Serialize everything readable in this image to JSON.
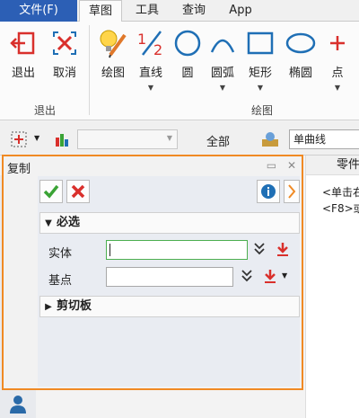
{
  "tabs": [
    {
      "label": "文件(F)"
    },
    {
      "label": "草图"
    },
    {
      "label": "工具"
    },
    {
      "label": "查询"
    },
    {
      "label": "App"
    }
  ],
  "ribbon": {
    "exit": "退出",
    "cancel": "取消",
    "draw": "绘图",
    "line": "直线",
    "circle": "圆",
    "arc": "圆弧",
    "rect": "矩形",
    "ellipse": "椭圆",
    "point": "点",
    "group_exit": "退出",
    "group_draw": "绘图"
  },
  "toolbar": {
    "filter_all": "全部",
    "curve_type": "单曲线"
  },
  "panel": {
    "title": "复制",
    "section_required": "必选",
    "entity_label": "实体",
    "basepoint_label": "基点",
    "section_clipboard": "剪切板"
  },
  "right": {
    "header": "零件",
    "line1": "<单击右",
    "line2": "<F8>或"
  },
  "colors": {
    "accent": "#f08a24",
    "file_tab": "#2c5fb5",
    "ok": "#3aa335",
    "cancel": "#d9302c"
  }
}
